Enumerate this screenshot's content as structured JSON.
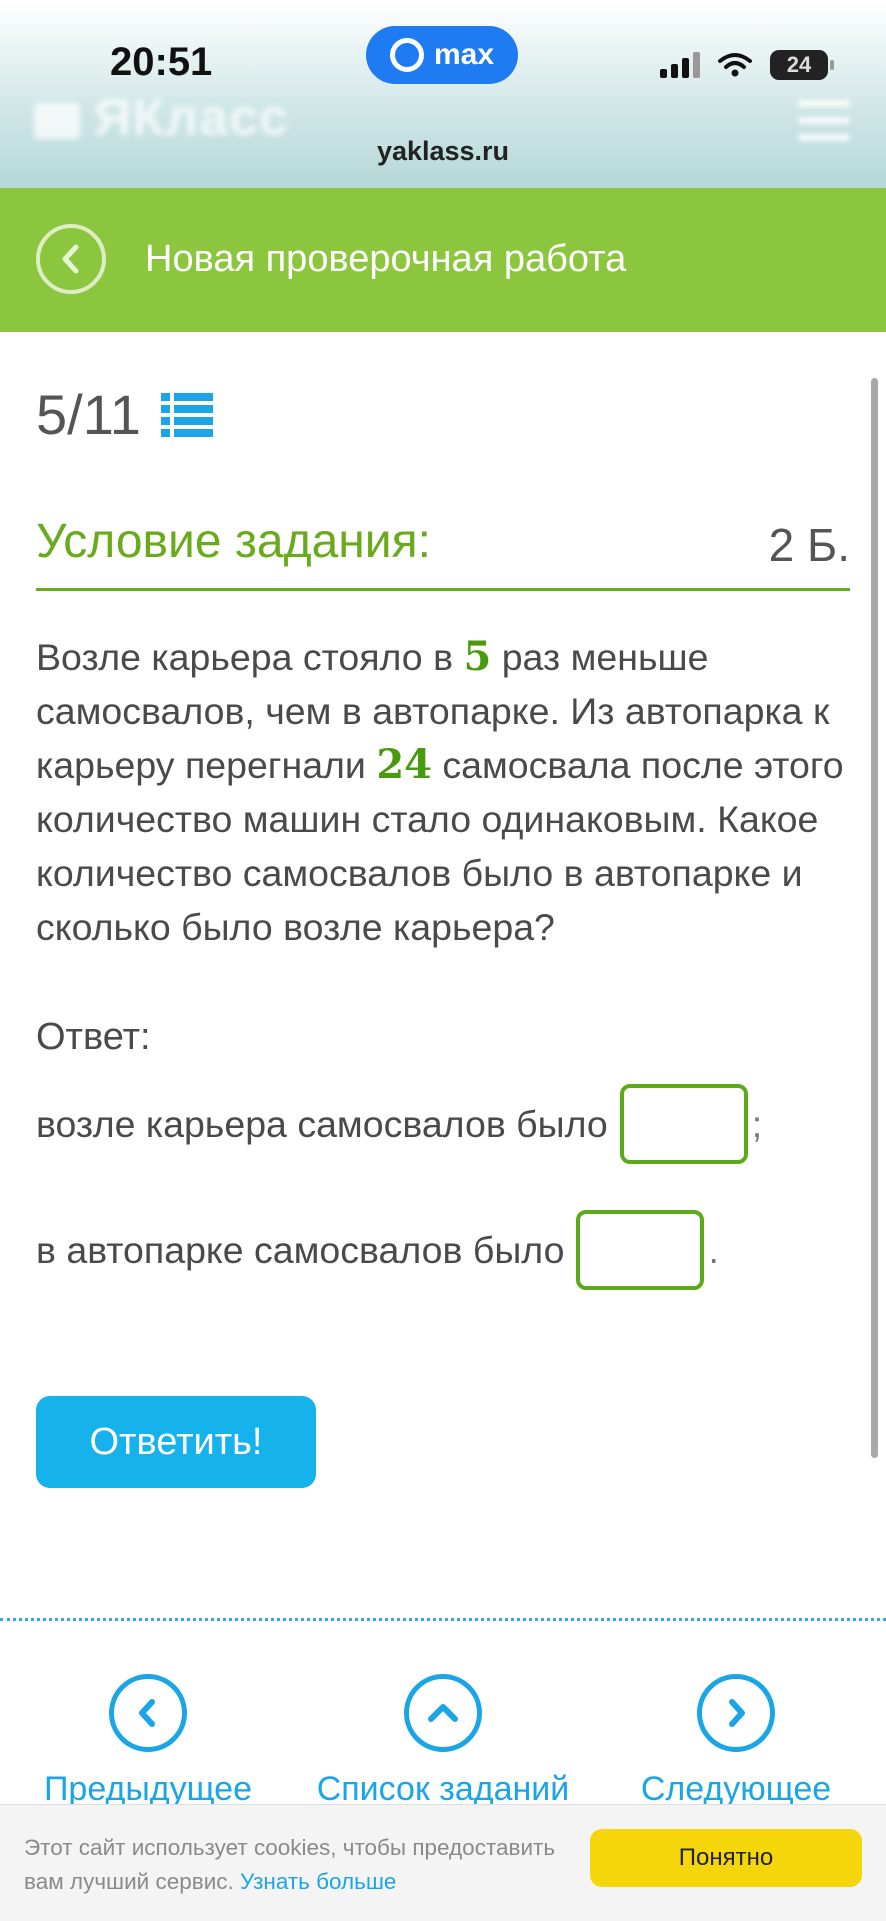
{
  "status_bar": {
    "time": "20:51",
    "messenger": "max",
    "battery": "24"
  },
  "browser": {
    "url": "yaklass.ru",
    "brand": "ЯКласс"
  },
  "header": {
    "title": "Новая проверочная работа"
  },
  "task": {
    "counter": "5/11",
    "section_title": "Условие задания:",
    "points": "2 Б.",
    "text": {
      "p1": "Возле карьера стояло в ",
      "n1": "5",
      "p2": " раз меньше самосвалов, чем в автопарке. Из автопарка к карьеру перегнали ",
      "n2": "24",
      "p3": " самосвала после этого количество машин стало одинаковым. Какое количество самосвалов было в автопарке и сколько было возле карьера?"
    },
    "answer_label": "Ответ:",
    "row1_label": "возле карьера самосвалов было",
    "row1_value": "",
    "row1_punct": ";",
    "row2_label": "в автопарке самосвалов было",
    "row2_value": "",
    "row2_punct": ".",
    "submit_label": "Ответить!"
  },
  "nav": {
    "prev_label": "Предыдущее",
    "list_label": "Список заданий",
    "next_label": "Следующее"
  },
  "cookie": {
    "text": "Этот сайт использует cookies, чтобы предоставить вам лучший сервис.",
    "link": "Узнать больше",
    "button": "Понятно"
  },
  "colors": {
    "header_green": "#8cc63f",
    "accent_green": "#6aab1e",
    "accent_blue": "#15b2ec",
    "cookie_button": "#f5d60a"
  }
}
